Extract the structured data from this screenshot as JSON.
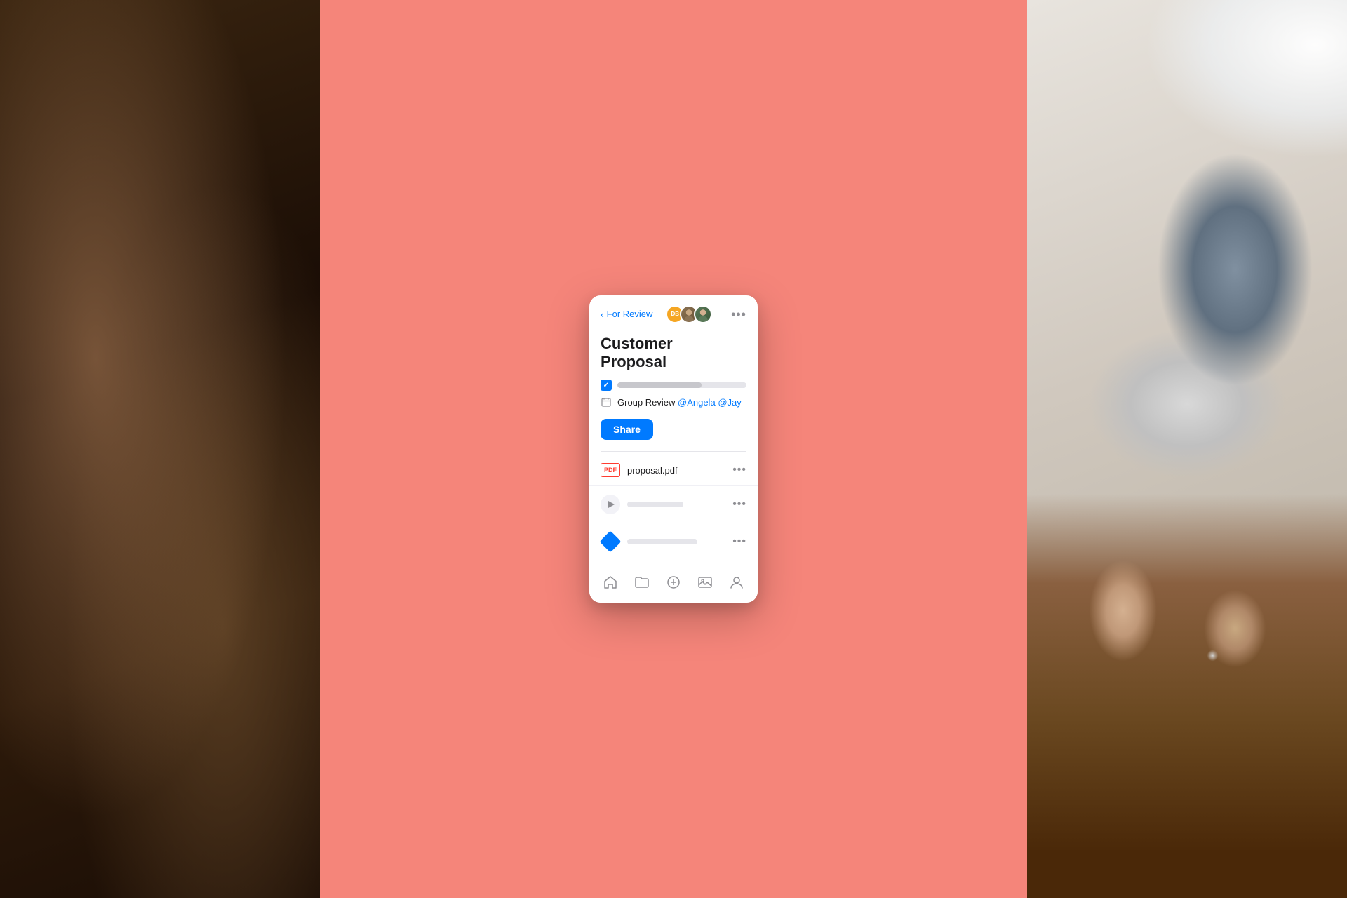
{
  "layout": {
    "panels": [
      "left-photo",
      "center",
      "right-photo"
    ]
  },
  "colors": {
    "background_center": "#f5857a",
    "card_bg": "#ffffff",
    "primary_blue": "#007AFF",
    "text_primary": "#1c1c1e",
    "text_secondary": "#8e8e93",
    "border": "#e5e5ea",
    "pdf_red": "#ff3b30"
  },
  "mobile_card": {
    "header": {
      "back_label": "For Review",
      "more_dots": "•••",
      "avatars": [
        {
          "initials": "DB",
          "color": "#f5a623",
          "type": "text"
        },
        {
          "type": "photo",
          "color": "#8B7355"
        },
        {
          "type": "photo",
          "color": "#5B7A5A"
        }
      ]
    },
    "title": "Customer\nProposal",
    "title_line1": "Customer",
    "title_line2": "Proposal",
    "meta": {
      "review_label": "Group Review",
      "mention1": "@Angela",
      "mention2": "@Jay"
    },
    "share_button": "Share",
    "files": [
      {
        "type": "pdf",
        "icon_label": "PDF",
        "name": "proposal.pdf",
        "more": "•••"
      },
      {
        "type": "video",
        "name_placeholder": true,
        "more": "•••"
      },
      {
        "type": "sketch",
        "name_placeholder": true,
        "more": "•••"
      }
    ],
    "bottom_nav": [
      {
        "icon": "home",
        "label": "Home"
      },
      {
        "icon": "folder",
        "label": "Files"
      },
      {
        "icon": "add",
        "label": "Add"
      },
      {
        "icon": "gallery",
        "label": "Gallery"
      },
      {
        "icon": "person",
        "label": "Profile"
      }
    ]
  }
}
